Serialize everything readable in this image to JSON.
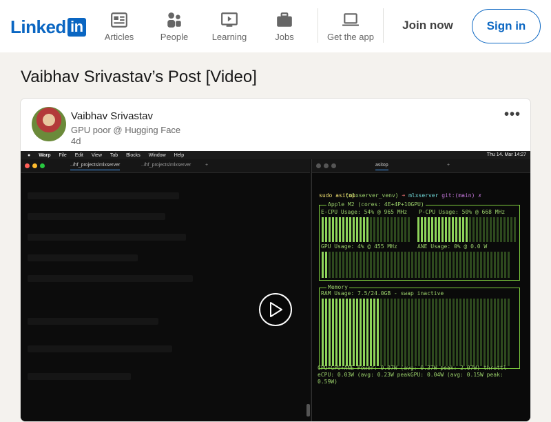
{
  "brand": {
    "word": "Linked",
    "badge": "in"
  },
  "nav": [
    {
      "label": "Articles",
      "icon": "articles-icon"
    },
    {
      "label": "People",
      "icon": "people-icon"
    },
    {
      "label": "Learning",
      "icon": "learning-icon"
    },
    {
      "label": "Jobs",
      "icon": "jobs-icon"
    },
    {
      "label": "Get the app",
      "icon": "laptop-icon"
    }
  ],
  "actions": {
    "join": "Join now",
    "signin": "Sign in"
  },
  "page": {
    "title": "Vaibhav Srivastav’s Post [Video]"
  },
  "post": {
    "author": "Vaibhav Srivastav",
    "subtitle": "GPU poor @ Hugging Face",
    "time": "4d",
    "more": "•••"
  },
  "video": {
    "menubar": {
      "app": "Warp",
      "items": [
        "File",
        "Edit",
        "View",
        "Tab",
        "Blocks",
        "Window",
        "Help"
      ],
      "clock": "Thu 14. Mar 14:27"
    },
    "left_tabs": [
      "../hf_projects/mlxserver",
      "../hf_projects/mlxserver"
    ],
    "right_tab": "asitop",
    "terminal": {
      "prompt_env": "(mlxserver_venv)",
      "prompt_arrow": "➜",
      "prompt_dir": "mlxserver",
      "prompt_git": "git:(main) ✗",
      "command": "sudo asitop",
      "chip_label": "Apple M2 (cores: 4E+4P+10GPU)",
      "ecpu": "E-CPU Usage: 54% @ 965 MHz",
      "pcpu": "P-CPU Usage: 50% @ 668 MHz",
      "gpu": "GPU Usage: 4% @ 455 MHz",
      "ane": "ANE Usage: 0% @ 0.0 W",
      "memory_label": "Memory",
      "ram": "RAM Usage: 7.5/24.0GB - swap inactive",
      "power1": "CPU+GPU+ANE Power: 0.07W (avg: 0.37W peak: 2.07W) throttl",
      "power2": "eCPU: 0.03W (avg: 0.23W peakGPU: 0.04W (avg: 0.15W peak:",
      "power3": "0.59W)"
    },
    "usage": {
      "ecpu": 0.54,
      "pcpu": 0.5,
      "gpu": 0.04,
      "ram": 0.31
    }
  },
  "colors": {
    "brand": "#0a66c2",
    "terminal_green": "#8ed45a"
  }
}
